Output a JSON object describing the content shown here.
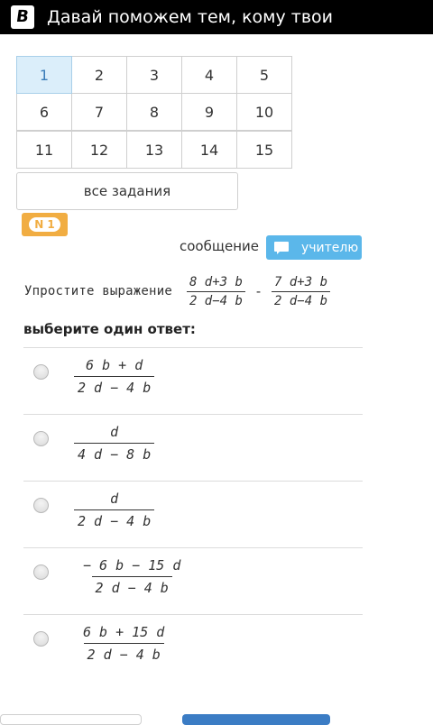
{
  "header": {
    "logo_letter": "B",
    "title": "Давай поможем тем, кому твои"
  },
  "task_grid": {
    "rows": [
      [
        "1",
        "2",
        "3",
        "4",
        "5"
      ],
      [
        "6",
        "7",
        "8",
        "9",
        "10"
      ],
      [
        "11",
        "12",
        "13",
        "14",
        "15"
      ]
    ],
    "active": "1",
    "all_tasks_label": "все задания"
  },
  "task_badge": "N 1",
  "message": {
    "label": "сообщение",
    "button_label": "учителю",
    "button_color": "#5bb7ea"
  },
  "question": {
    "text": "Упростите выражение",
    "frac1": {
      "num": "8 d+3 b",
      "den": "2 d−4 b"
    },
    "operator": "-",
    "frac2": {
      "num": "7 d+3 b",
      "den": "2 d−4 b"
    }
  },
  "choose_label": "выберите один ответ:",
  "answers": [
    {
      "num": "6 b + d",
      "den": "2 d − 4 b"
    },
    {
      "num": "d",
      "den": "4 d − 8 b"
    },
    {
      "num": "d",
      "den": "2 d − 4 b"
    },
    {
      "num": "− 6 b − 15 d",
      "den": "2 d − 4 b"
    },
    {
      "num": "6 b + 15 d",
      "den": "2 d − 4 b"
    }
  ],
  "colors": {
    "badge": "#f1ad42",
    "active_cell": "#dbeefa",
    "primary_button": "#3b7cc4"
  }
}
